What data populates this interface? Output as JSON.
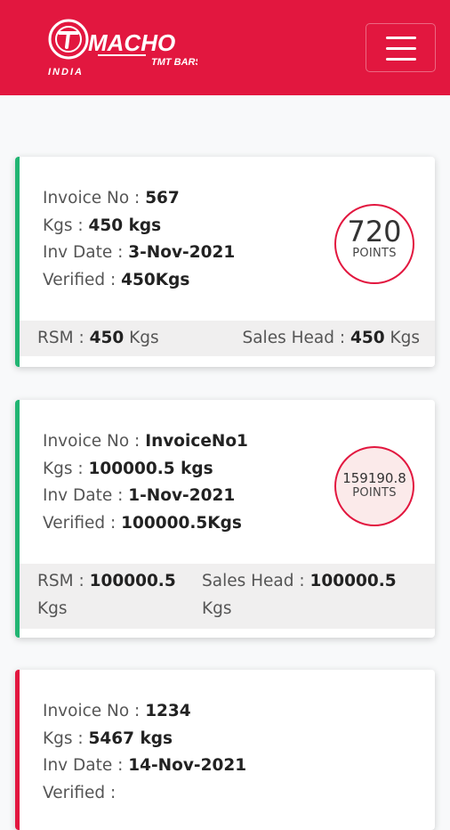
{
  "brand": {
    "name": "MACHO",
    "tagline": "TMT BARS",
    "region": "INDIA",
    "color": "#e2173f"
  },
  "menu_icon": "hamburger-menu-icon",
  "labels": {
    "invoice_no": "Invoice No :",
    "kgs": "Kgs :",
    "inv_date": "Inv Date :",
    "verified": "Verified :",
    "points": "POINTS",
    "rsm": "RSM :",
    "sales_head": "Sales Head :"
  },
  "invoices": [
    {
      "invoice_no": "567",
      "kgs": "450 kgs",
      "inv_date": "3-Nov-2021",
      "verified": "450Kgs",
      "points": "720",
      "rsm_value": "450",
      "rsm_unit": "Kgs",
      "sales_head_value": "450",
      "sales_head_unit": "Kgs",
      "status_color": "#22b573"
    },
    {
      "invoice_no": "InvoiceNo1",
      "kgs": "100000.5 kgs",
      "inv_date": "1-Nov-2021",
      "verified": "100000.5Kgs",
      "points": "159190.8",
      "rsm_value": "100000.5",
      "rsm_unit": "Kgs",
      "sales_head_value": "100000.5",
      "sales_head_unit": "Kgs",
      "status_color": "#22b573"
    },
    {
      "invoice_no": "1234",
      "kgs": "5467 kgs",
      "inv_date": "14-Nov-2021",
      "verified": "",
      "status_color": "#e2173f"
    }
  ]
}
